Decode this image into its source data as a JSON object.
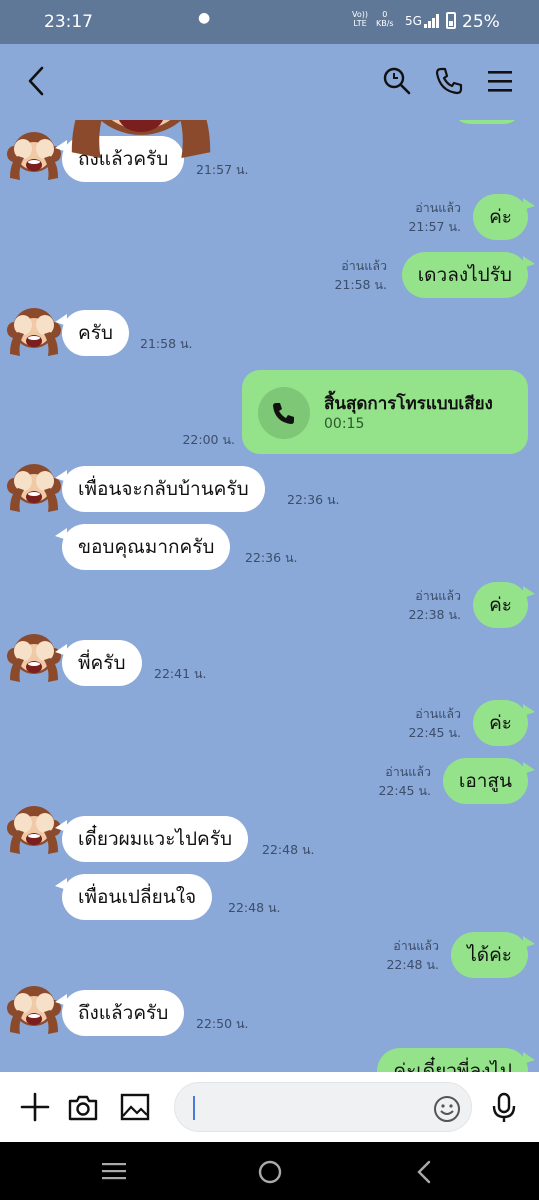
{
  "status_bar": {
    "time": "23:17",
    "network_label_top": "Vo))",
    "network_label_bottom": "LTE",
    "speed_top": "0",
    "speed_bottom": "KB/s",
    "network_type": "5G",
    "battery": "25%",
    "icons": [
      "signal-icon",
      "battery-icon"
    ]
  },
  "header": {
    "icons": [
      "back-icon",
      "search-icon",
      "phone-icon",
      "menu-icon"
    ]
  },
  "messages": [
    {
      "dir": "in",
      "text": "ถึงแล้วครับ",
      "time": "21:57 น."
    },
    {
      "dir": "out",
      "text": "ค่ะ",
      "read": "อ่านแล้ว",
      "time": "21:57 น."
    },
    {
      "dir": "out",
      "text": "เดวลงไปรับ",
      "read": "อ่านแล้ว",
      "time": "21:58 น."
    },
    {
      "dir": "in",
      "text": "ครับ",
      "time": "21:58 น."
    },
    {
      "dir": "in",
      "text": "เพื่อนจะกลับบ้านครับ",
      "time": "22:36 น."
    },
    {
      "dir": "in",
      "text": "ขอบคุณมากครับ",
      "time": "22:36 น."
    },
    {
      "dir": "out",
      "text": "ค่ะ",
      "read": "อ่านแล้ว",
      "time": "22:38 น."
    },
    {
      "dir": "in",
      "text": "พี่ครับ",
      "time": "22:41 น."
    },
    {
      "dir": "out",
      "text": "ค่ะ",
      "read": "อ่านแล้ว",
      "time": "22:45 น."
    },
    {
      "dir": "out",
      "text": "เอาสูน",
      "read": "อ่านแล้ว",
      "time": "22:45 น."
    },
    {
      "dir": "in",
      "text": "เดี๋ยวผมแวะไปครับ",
      "time": "22:48 น."
    },
    {
      "dir": "in",
      "text": "เพื่อนเปลี่ยนใจ",
      "time": "22:48 น."
    },
    {
      "dir": "out",
      "text": "ได้ค่ะ",
      "read": "อ่านแล้ว",
      "time": "22:48 น."
    },
    {
      "dir": "in",
      "text": "ถึงแล้วครับ",
      "time": "22:50 น."
    },
    {
      "dir": "out",
      "text": "ค่ะเดี๋ยวพี่ลงไป",
      "read": "",
      "time": ""
    }
  ],
  "call": {
    "title": "สิ้นสุดการโทรแบบเสียง",
    "duration": "00:15",
    "time": "22:00 น."
  },
  "input_bar": {
    "placeholder": "",
    "icons": [
      "plus-icon",
      "camera-icon",
      "image-icon",
      "emoji-icon",
      "mic-icon"
    ]
  },
  "nav_bar": {
    "icons": [
      "recents-icon",
      "home-icon",
      "back-nav-icon"
    ]
  },
  "colors": {
    "chat_background": "#8aa8d8",
    "outgoing_bubble": "#94e28a",
    "incoming_bubble": "#ffffff",
    "status_bar": "#5f7898"
  }
}
